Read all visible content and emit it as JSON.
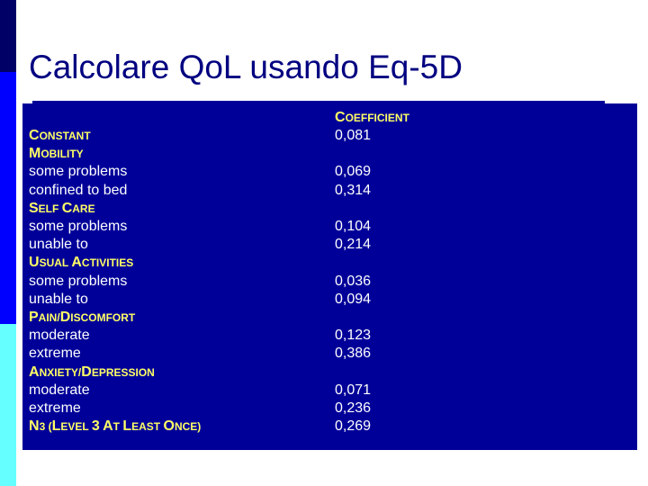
{
  "title": "Calcolare QoL usando Eq-5D",
  "coefficient_header": "COEFFICIENT",
  "rows": [
    {
      "label": "CONSTANT",
      "heading": true,
      "value": "0,081"
    },
    {
      "label": "MOBILITY",
      "heading": true,
      "value": ""
    },
    {
      "label": "some problems",
      "heading": false,
      "value": "0,069"
    },
    {
      "label": "confined to bed",
      "heading": false,
      "value": "0,314"
    },
    {
      "label": "SELF CARE",
      "heading": true,
      "value": ""
    },
    {
      "label": "some problems",
      "heading": false,
      "value": "0,104"
    },
    {
      "label": "unable to",
      "heading": false,
      "value": "0,214"
    },
    {
      "label": "USUAL ACTIVITIES",
      "heading": true,
      "value": ""
    },
    {
      "label": "some problems",
      "heading": false,
      "value": "0,036"
    },
    {
      "label": "unable to",
      "heading": false,
      "value": "0,094"
    },
    {
      "label": "PAIN/DISCOMFORT",
      "heading": true,
      "value": ""
    },
    {
      "label": "moderate",
      "heading": false,
      "value": "0,123"
    },
    {
      "label": "extreme",
      "heading": false,
      "value": "0,386"
    },
    {
      "label": "ANXIETY/DEPRESSION",
      "heading": true,
      "value": ""
    },
    {
      "label": "moderate",
      "heading": false,
      "value": "0,071"
    },
    {
      "label": "extreme",
      "heading": false,
      "value": "0,236"
    },
    {
      "label": "N3 (LEVEL 3 AT LEAST ONCE)",
      "heading": true,
      "value": "0,269"
    }
  ]
}
